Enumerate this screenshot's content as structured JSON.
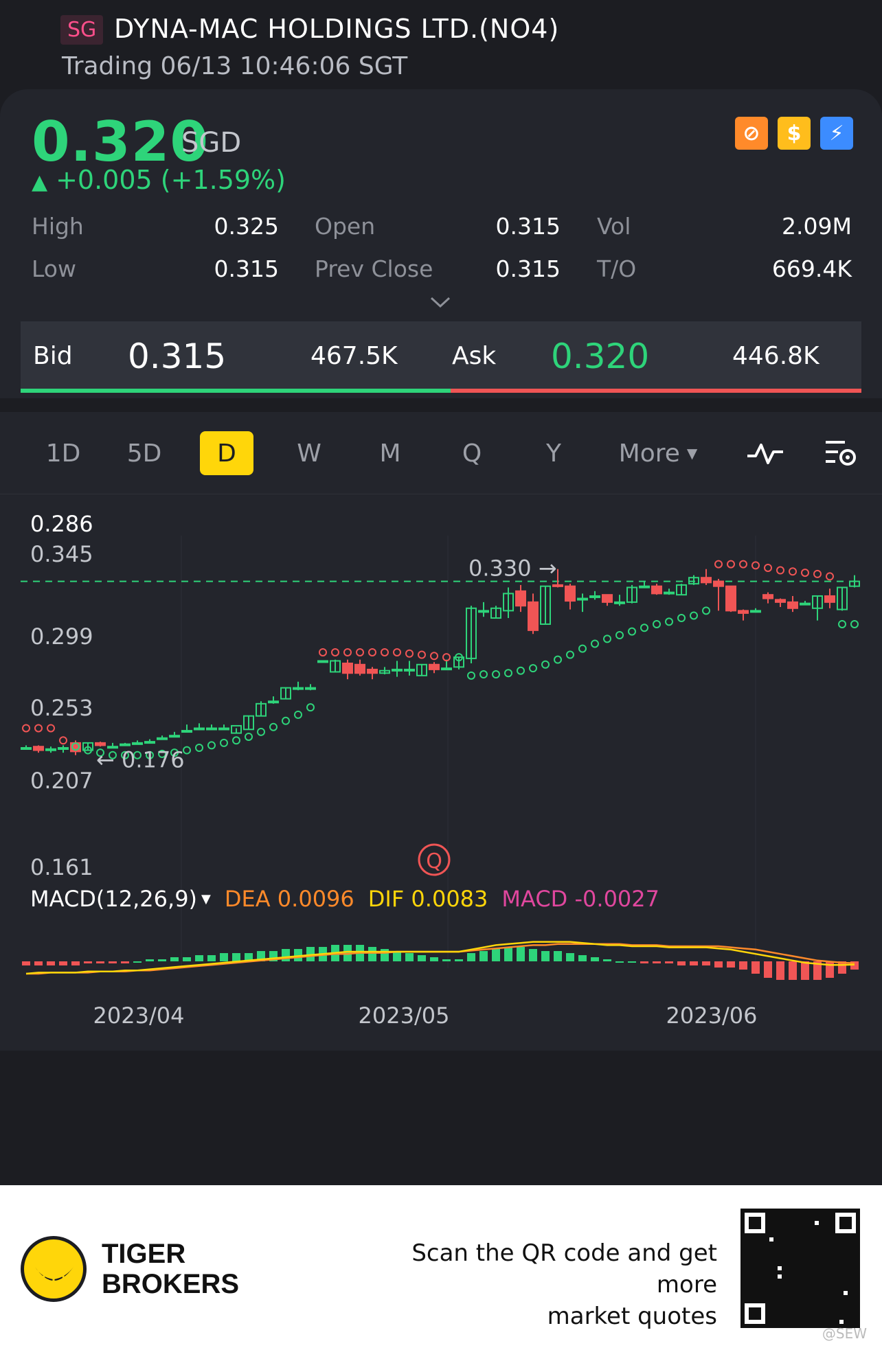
{
  "header": {
    "market_tag": "SG",
    "name": "DYNA-MAC HOLDINGS LTD.(NO4)",
    "trading_time": "Trading 06/13 10:46:06 SGT"
  },
  "quote": {
    "price": "0.320",
    "currency": "SGD",
    "change": "+0.005 (+1.59%)",
    "stats": [
      [
        {
          "label": "High",
          "value": "0.325"
        },
        {
          "label": "Open",
          "value": "0.315"
        },
        {
          "label": "Vol",
          "value": "2.09M"
        }
      ],
      [
        {
          "label": "Low",
          "value": "0.315"
        },
        {
          "label": "Prev Close",
          "value": "0.315"
        },
        {
          "label": "T/O",
          "value": "669.4K"
        }
      ]
    ],
    "colors": {
      "up": "#2ed47a",
      "down": "#f05555"
    }
  },
  "bidask": {
    "bid_label": "Bid",
    "bid_price": "0.315",
    "bid_size": "467.5K",
    "ask_label": "Ask",
    "ask_price": "0.320",
    "ask_size": "446.8K"
  },
  "periods": {
    "tabs": [
      "1D",
      "5D",
      "D",
      "W",
      "M",
      "Q",
      "Y"
    ],
    "active": "D",
    "more_label": "More"
  },
  "chart_data": {
    "type": "candlestick",
    "y_labels": [
      "0.286",
      "0.345",
      "0.299",
      "0.253",
      "0.207",
      "0.161"
    ],
    "x_labels": [
      "2023/04",
      "2023/05",
      "2023/06"
    ],
    "annotations": {
      "high_marker": "0.330",
      "low_marker": "0.176",
      "event_marker": "Q"
    },
    "last_price": 0.32,
    "candles": [
      {
        "o": 0.184,
        "h": 0.186,
        "c": 0.184,
        "l": 0.183
      },
      {
        "o": 0.185,
        "h": 0.186,
        "c": 0.182,
        "l": 0.18
      },
      {
        "o": 0.183,
        "h": 0.185,
        "c": 0.183,
        "l": 0.18
      },
      {
        "o": 0.183,
        "h": 0.186,
        "c": 0.184,
        "l": 0.18
      },
      {
        "o": 0.188,
        "h": 0.19,
        "c": 0.181,
        "l": 0.178
      },
      {
        "o": 0.182,
        "h": 0.188,
        "c": 0.188,
        "l": 0.182
      },
      {
        "o": 0.188,
        "h": 0.189,
        "c": 0.186,
        "l": 0.185
      },
      {
        "o": 0.185,
        "h": 0.188,
        "c": 0.185,
        "l": 0.184
      },
      {
        "o": 0.187,
        "h": 0.188,
        "c": 0.187,
        "l": 0.186
      },
      {
        "o": 0.188,
        "h": 0.19,
        "c": 0.188,
        "l": 0.187
      },
      {
        "o": 0.189,
        "h": 0.191,
        "c": 0.189,
        "l": 0.188
      },
      {
        "o": 0.192,
        "h": 0.194,
        "c": 0.192,
        "l": 0.191
      },
      {
        "o": 0.194,
        "h": 0.197,
        "c": 0.194,
        "l": 0.193
      },
      {
        "o": 0.198,
        "h": 0.203,
        "c": 0.198,
        "l": 0.197
      },
      {
        "o": 0.2,
        "h": 0.204,
        "c": 0.2,
        "l": 0.199
      },
      {
        "o": 0.2,
        "h": 0.203,
        "c": 0.2,
        "l": 0.199
      },
      {
        "o": 0.2,
        "h": 0.203,
        "c": 0.2,
        "l": 0.199
      },
      {
        "o": 0.196,
        "h": 0.2,
        "c": 0.202,
        "l": 0.196
      },
      {
        "o": 0.199,
        "h": 0.21,
        "c": 0.21,
        "l": 0.199
      },
      {
        "o": 0.21,
        "h": 0.222,
        "c": 0.22,
        "l": 0.21
      },
      {
        "o": 0.222,
        "h": 0.226,
        "c": 0.222,
        "l": 0.22
      },
      {
        "o": 0.224,
        "h": 0.233,
        "c": 0.233,
        "l": 0.224
      },
      {
        "o": 0.233,
        "h": 0.238,
        "c": 0.233,
        "l": 0.231
      },
      {
        "o": 0.233,
        "h": 0.236,
        "c": 0.233,
        "l": 0.231
      },
      {
        "o": 0.255,
        "h": 0.255,
        "c": 0.255,
        "l": 0.254
      },
      {
        "o": 0.246,
        "h": 0.256,
        "c": 0.255,
        "l": 0.246
      },
      {
        "o": 0.253,
        "h": 0.256,
        "c": 0.245,
        "l": 0.24
      },
      {
        "o": 0.252,
        "h": 0.256,
        "c": 0.245,
        "l": 0.243
      },
      {
        "o": 0.248,
        "h": 0.25,
        "c": 0.245,
        "l": 0.24
      },
      {
        "o": 0.245,
        "h": 0.25,
        "c": 0.247,
        "l": 0.244
      },
      {
        "o": 0.248,
        "h": 0.255,
        "c": 0.248,
        "l": 0.242
      },
      {
        "o": 0.248,
        "h": 0.255,
        "c": 0.248,
        "l": 0.243
      },
      {
        "o": 0.243,
        "h": 0.252,
        "c": 0.252,
        "l": 0.243
      },
      {
        "o": 0.252,
        "h": 0.254,
        "c": 0.248,
        "l": 0.245
      },
      {
        "o": 0.249,
        "h": 0.256,
        "c": 0.249,
        "l": 0.248
      },
      {
        "o": 0.25,
        "h": 0.258,
        "c": 0.258,
        "l": 0.248
      },
      {
        "o": 0.257,
        "h": 0.3,
        "c": 0.298,
        "l": 0.253
      },
      {
        "o": 0.296,
        "h": 0.303,
        "c": 0.296,
        "l": 0.291
      },
      {
        "o": 0.29,
        "h": 0.3,
        "c": 0.298,
        "l": 0.29
      },
      {
        "o": 0.296,
        "h": 0.315,
        "c": 0.31,
        "l": 0.29
      },
      {
        "o": 0.312,
        "h": 0.317,
        "c": 0.3,
        "l": 0.295
      },
      {
        "o": 0.303,
        "h": 0.31,
        "c": 0.28,
        "l": 0.277
      },
      {
        "o": 0.285,
        "h": 0.316,
        "c": 0.316,
        "l": 0.285
      },
      {
        "o": 0.317,
        "h": 0.33,
        "c": 0.316,
        "l": 0.315
      },
      {
        "o": 0.316,
        "h": 0.318,
        "c": 0.304,
        "l": 0.297
      },
      {
        "o": 0.306,
        "h": 0.31,
        "c": 0.306,
        "l": 0.295
      },
      {
        "o": 0.308,
        "h": 0.312,
        "c": 0.308,
        "l": 0.305
      },
      {
        "o": 0.309,
        "h": 0.309,
        "c": 0.303,
        "l": 0.3
      },
      {
        "o": 0.303,
        "h": 0.309,
        "c": 0.303,
        "l": 0.3
      },
      {
        "o": 0.303,
        "h": 0.317,
        "c": 0.315,
        "l": 0.302
      },
      {
        "o": 0.316,
        "h": 0.32,
        "c": 0.316,
        "l": 0.315
      },
      {
        "o": 0.316,
        "h": 0.318,
        "c": 0.31,
        "l": 0.309
      },
      {
        "o": 0.311,
        "h": 0.314,
        "c": 0.311,
        "l": 0.309
      },
      {
        "o": 0.309,
        "h": 0.318,
        "c": 0.317,
        "l": 0.309
      },
      {
        "o": 0.318,
        "h": 0.325,
        "c": 0.323,
        "l": 0.317
      },
      {
        "o": 0.323,
        "h": 0.33,
        "c": 0.319,
        "l": 0.317
      },
      {
        "o": 0.32,
        "h": 0.322,
        "c": 0.316,
        "l": 0.296
      },
      {
        "o": 0.316,
        "h": 0.316,
        "c": 0.296,
        "l": 0.295
      },
      {
        "o": 0.296,
        "h": 0.297,
        "c": 0.294,
        "l": 0.288
      },
      {
        "o": 0.296,
        "h": 0.298,
        "c": 0.296,
        "l": 0.295
      },
      {
        "o": 0.309,
        "h": 0.311,
        "c": 0.306,
        "l": 0.302
      },
      {
        "o": 0.305,
        "h": 0.306,
        "c": 0.303,
        "l": 0.299
      },
      {
        "o": 0.303,
        "h": 0.308,
        "c": 0.298,
        "l": 0.295
      },
      {
        "o": 0.302,
        "h": 0.304,
        "c": 0.302,
        "l": 0.301
      },
      {
        "o": 0.298,
        "h": 0.308,
        "c": 0.308,
        "l": 0.288
      },
      {
        "o": 0.308,
        "h": 0.314,
        "c": 0.303,
        "l": 0.298
      },
      {
        "o": 0.297,
        "h": 0.315,
        "c": 0.315,
        "l": 0.296
      },
      {
        "o": 0.316,
        "h": 0.325,
        "c": 0.32,
        "l": 0.315
      }
    ],
    "sar": [
      {
        "i": 0,
        "v": 0.2
      },
      {
        "i": 1,
        "v": 0.2
      },
      {
        "i": 2,
        "v": 0.2
      },
      {
        "i": 3,
        "v": 0.19
      },
      {
        "i": 4,
        "v": 0.185
      },
      {
        "i": 5,
        "v": 0.182
      },
      {
        "i": 6,
        "v": 0.18
      },
      {
        "i": 7,
        "v": 0.178
      },
      {
        "i": 8,
        "v": 0.178
      },
      {
        "i": 9,
        "v": 0.178
      },
      {
        "i": 10,
        "v": 0.178
      },
      {
        "i": 11,
        "v": 0.179
      },
      {
        "i": 12,
        "v": 0.18
      },
      {
        "i": 13,
        "v": 0.182
      },
      {
        "i": 14,
        "v": 0.184
      },
      {
        "i": 15,
        "v": 0.186
      },
      {
        "i": 16,
        "v": 0.188
      },
      {
        "i": 17,
        "v": 0.19
      },
      {
        "i": 18,
        "v": 0.193
      },
      {
        "i": 19,
        "v": 0.197
      },
      {
        "i": 20,
        "v": 0.201
      },
      {
        "i": 21,
        "v": 0.206
      },
      {
        "i": 22,
        "v": 0.211
      },
      {
        "i": 23,
        "v": 0.217
      },
      {
        "i": 24,
        "v": 0.262
      },
      {
        "i": 25,
        "v": 0.262
      },
      {
        "i": 26,
        "v": 0.262
      },
      {
        "i": 27,
        "v": 0.262
      },
      {
        "i": 28,
        "v": 0.262
      },
      {
        "i": 29,
        "v": 0.262
      },
      {
        "i": 30,
        "v": 0.262
      },
      {
        "i": 31,
        "v": 0.261
      },
      {
        "i": 32,
        "v": 0.26
      },
      {
        "i": 33,
        "v": 0.259
      },
      {
        "i": 34,
        "v": 0.258
      },
      {
        "i": 35,
        "v": 0.258
      },
      {
        "i": 36,
        "v": 0.243
      },
      {
        "i": 37,
        "v": 0.244
      },
      {
        "i": 38,
        "v": 0.244
      },
      {
        "i": 39,
        "v": 0.245
      },
      {
        "i": 40,
        "v": 0.247
      },
      {
        "i": 41,
        "v": 0.249
      },
      {
        "i": 42,
        "v": 0.252
      },
      {
        "i": 43,
        "v": 0.256
      },
      {
        "i": 44,
        "v": 0.26
      },
      {
        "i": 45,
        "v": 0.265
      },
      {
        "i": 46,
        "v": 0.269
      },
      {
        "i": 47,
        "v": 0.273
      },
      {
        "i": 48,
        "v": 0.276
      },
      {
        "i": 49,
        "v": 0.279
      },
      {
        "i": 50,
        "v": 0.282
      },
      {
        "i": 51,
        "v": 0.285
      },
      {
        "i": 52,
        "v": 0.287
      },
      {
        "i": 53,
        "v": 0.29
      },
      {
        "i": 54,
        "v": 0.292
      },
      {
        "i": 55,
        "v": 0.296
      },
      {
        "i": 56,
        "v": 0.334
      },
      {
        "i": 57,
        "v": 0.334
      },
      {
        "i": 58,
        "v": 0.334
      },
      {
        "i": 59,
        "v": 0.333
      },
      {
        "i": 60,
        "v": 0.331
      },
      {
        "i": 61,
        "v": 0.329
      },
      {
        "i": 62,
        "v": 0.328
      },
      {
        "i": 63,
        "v": 0.327
      },
      {
        "i": 64,
        "v": 0.326
      },
      {
        "i": 65,
        "v": 0.324
      },
      {
        "i": 66,
        "v": 0.285
      },
      {
        "i": 67,
        "v": 0.285
      }
    ],
    "macd": {
      "name": "MACD(12,26,9)",
      "dea_label": "DEA 0.0096",
      "dif_label": "DIF 0.0083",
      "macd_label": "MACD -0.0027",
      "hist": [
        -0.002,
        -0.002,
        -0.002,
        -0.002,
        -0.002,
        -0.001,
        -0.001,
        -0.001,
        -0.001,
        0,
        0.001,
        0.001,
        0.002,
        0.002,
        0.003,
        0.003,
        0.004,
        0.004,
        0.004,
        0.005,
        0.005,
        0.006,
        0.006,
        0.007,
        0.007,
        0.008,
        0.008,
        0.008,
        0.007,
        0.006,
        0.005,
        0.004,
        0.003,
        0.002,
        0.001,
        0.001,
        0.004,
        0.005,
        0.006,
        0.007,
        0.007,
        0.006,
        0.005,
        0.005,
        0.004,
        0.003,
        0.002,
        0.001,
        0,
        0,
        -0.001,
        -0.001,
        -0.001,
        -0.002,
        -0.002,
        -0.002,
        -0.003,
        -0.003,
        -0.004,
        -0.006,
        -0.008,
        -0.009,
        -0.009,
        -0.009,
        -0.009,
        -0.008,
        -0.006,
        -0.004
      ],
      "dif": [
        0,
        0.001,
        0.001,
        0.001,
        0.001,
        0.002,
        0.002,
        0.002,
        0.003,
        0.003,
        0.004,
        0.005,
        0.006,
        0.007,
        0.008,
        0.009,
        0.01,
        0.011,
        0.012,
        0.013,
        0.014,
        0.015,
        0.016,
        0.017,
        0.018,
        0.019,
        0.02,
        0.02,
        0.02,
        0.02,
        0.02,
        0.02,
        0.02,
        0.02,
        0.02,
        0.02,
        0.022,
        0.024,
        0.026,
        0.027,
        0.028,
        0.029,
        0.029,
        0.029,
        0.029,
        0.028,
        0.027,
        0.026,
        0.026,
        0.025,
        0.025,
        0.025,
        0.024,
        0.024,
        0.024,
        0.024,
        0.023,
        0.022,
        0.02,
        0.018,
        0.016,
        0.014,
        0.012,
        0.01,
        0.009,
        0.008,
        0.008,
        0.0083
      ],
      "dea": [
        0,
        0.0,
        0.001,
        0.001,
        0.001,
        0.001,
        0.002,
        0.002,
        0.002,
        0.003,
        0.003,
        0.004,
        0.005,
        0.006,
        0.007,
        0.008,
        0.009,
        0.01,
        0.011,
        0.012,
        0.013,
        0.014,
        0.015,
        0.016,
        0.017,
        0.018,
        0.018,
        0.019,
        0.019,
        0.019,
        0.02,
        0.02,
        0.02,
        0.02,
        0.02,
        0.02,
        0.021,
        0.022,
        0.023,
        0.024,
        0.025,
        0.026,
        0.026,
        0.027,
        0.027,
        0.027,
        0.027,
        0.027,
        0.027,
        0.026,
        0.026,
        0.026,
        0.025,
        0.025,
        0.025,
        0.025,
        0.025,
        0.024,
        0.023,
        0.022,
        0.02,
        0.018,
        0.016,
        0.014,
        0.012,
        0.011,
        0.01,
        0.0096
      ]
    }
  },
  "footer": {
    "brand_line1": "TIGER",
    "brand_line2": "BROKERS",
    "scan_line1": "Scan the QR code and get more",
    "scan_line2": "market quotes",
    "watermark": "@SEW"
  }
}
